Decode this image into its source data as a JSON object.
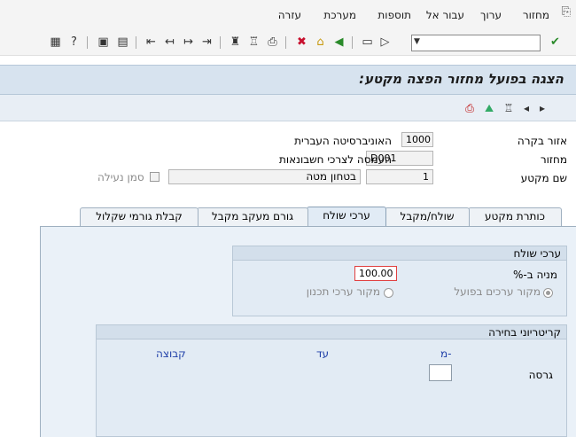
{
  "menu": {
    "items": [
      {
        "name": "menu-return",
        "label": "מחזור"
      },
      {
        "name": "menu-edit",
        "label": "ערוך"
      },
      {
        "name": "menu-goto",
        "label": "עבור אל"
      },
      {
        "name": "menu-extras",
        "label": "תוספות"
      },
      {
        "name": "menu-system",
        "label": "מערכת"
      },
      {
        "name": "menu-help",
        "label": "עזרה"
      }
    ]
  },
  "command_field": {
    "value": ""
  },
  "title": "הצגה בפועל מחזור הפצה מקטע:",
  "form": {
    "controlling_area": {
      "label": "אזור בקרה",
      "value": "1000",
      "desc": "האוניברסיטה העברית"
    },
    "cycle": {
      "label": "מחזור",
      "value": "D001",
      "desc": "העמסה לצרכי חשבונאות"
    },
    "segment_name": {
      "label": "שם מקטע",
      "value": "1",
      "desc": "בטחון מטה"
    },
    "lock_indicator": {
      "label": "סמן נעילה"
    }
  },
  "tabs": [
    {
      "label": "כותרת מקטע"
    },
    {
      "label": "שולח/מקבל"
    },
    {
      "label": "ערכי שולח"
    },
    {
      "label": "גורם מעקב מקבל"
    },
    {
      "label": "קבלת גורמי שקלול"
    }
  ],
  "sender_values": {
    "heading": "ערכי שולח",
    "share_label": "מניה ב-%",
    "share_value": "100.00",
    "actual_source": "מקור ערכים בפועל",
    "plan_source": "מקור ערכי תכנון"
  },
  "selection_criteria": {
    "heading": "קריטריוני בחירה",
    "col_from": "מ-",
    "col_to": "עד",
    "col_group": "קבוצה",
    "version_label": "גרסה"
  }
}
